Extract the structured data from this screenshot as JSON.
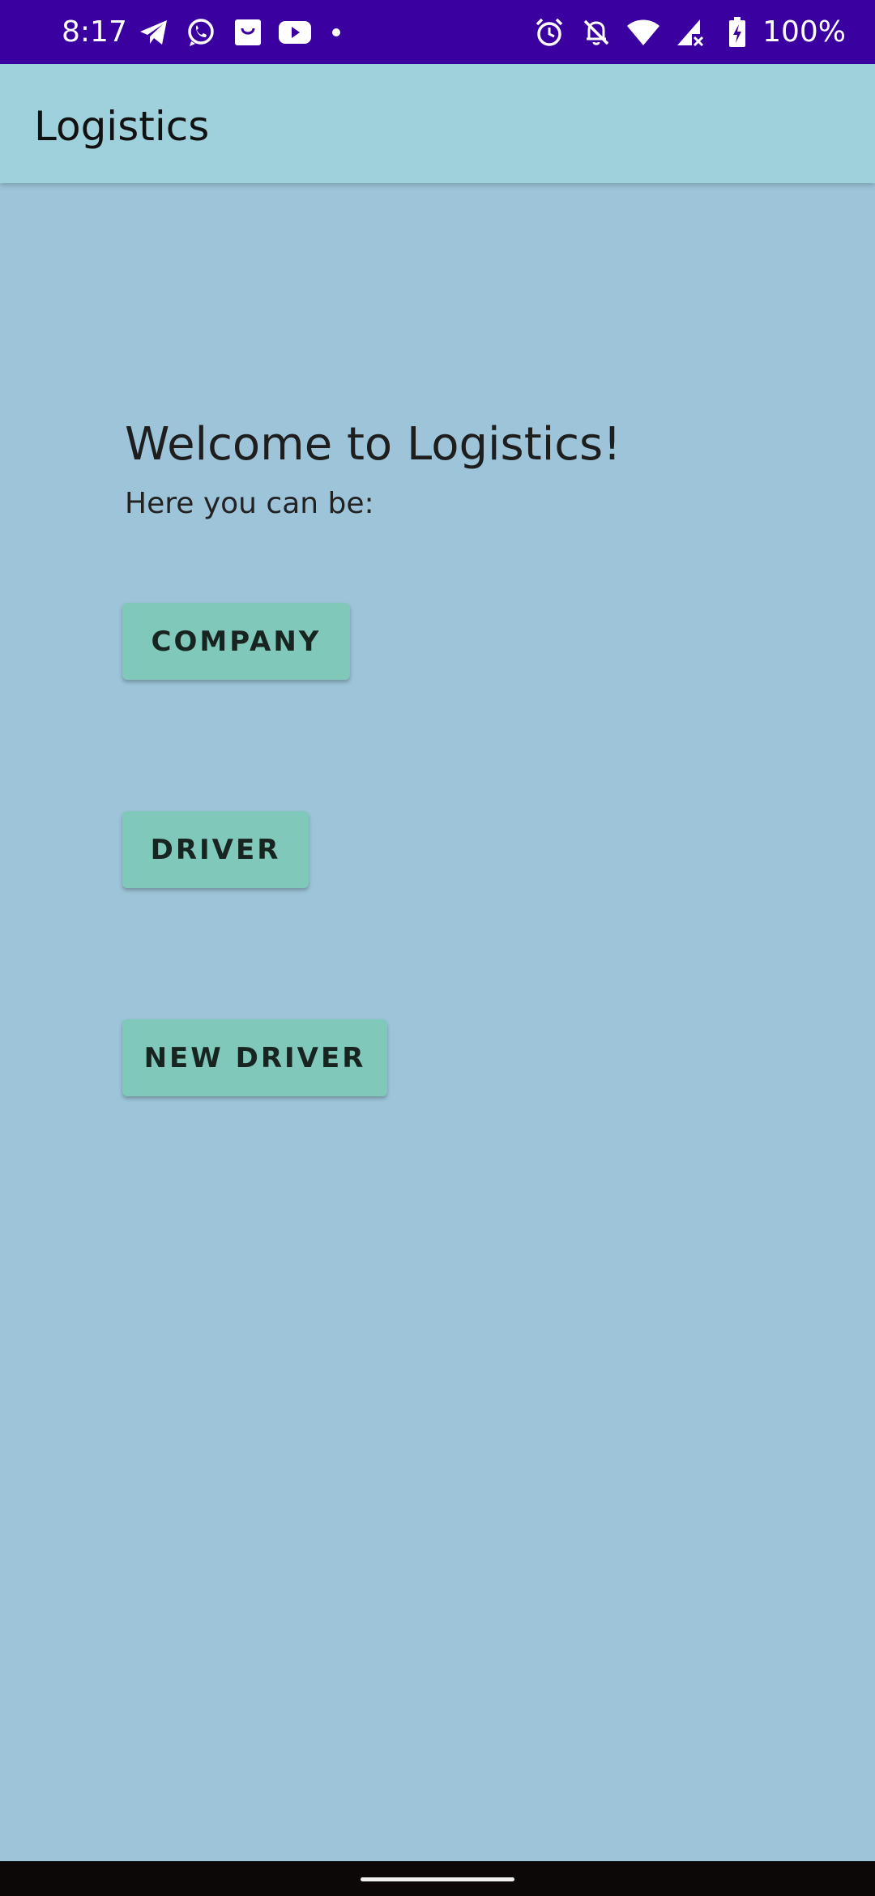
{
  "status_bar": {
    "time": "8:17",
    "battery_percent": "100%",
    "background_color": "#3a00a0",
    "left_icons": [
      "telegram-icon",
      "whatsapp-icon",
      "shopping-bag-icon",
      "youtube-icon",
      "notification-dot-icon"
    ],
    "right_icons": [
      "alarm-icon",
      "notifications-off-icon",
      "wifi-icon",
      "cellular-signal-icon",
      "battery-charging-icon"
    ]
  },
  "app_bar": {
    "title": "Logistics",
    "background_color": "#9fd1dd"
  },
  "main": {
    "background_color": "#9dc4d9",
    "welcome": "Welcome to Logistics!",
    "subtitle": "Here you can be:",
    "buttons": {
      "company": "COMPANY",
      "driver": "DRIVER",
      "new_driver": "NEW DRIVER"
    },
    "button_color": "#80c8b9"
  }
}
